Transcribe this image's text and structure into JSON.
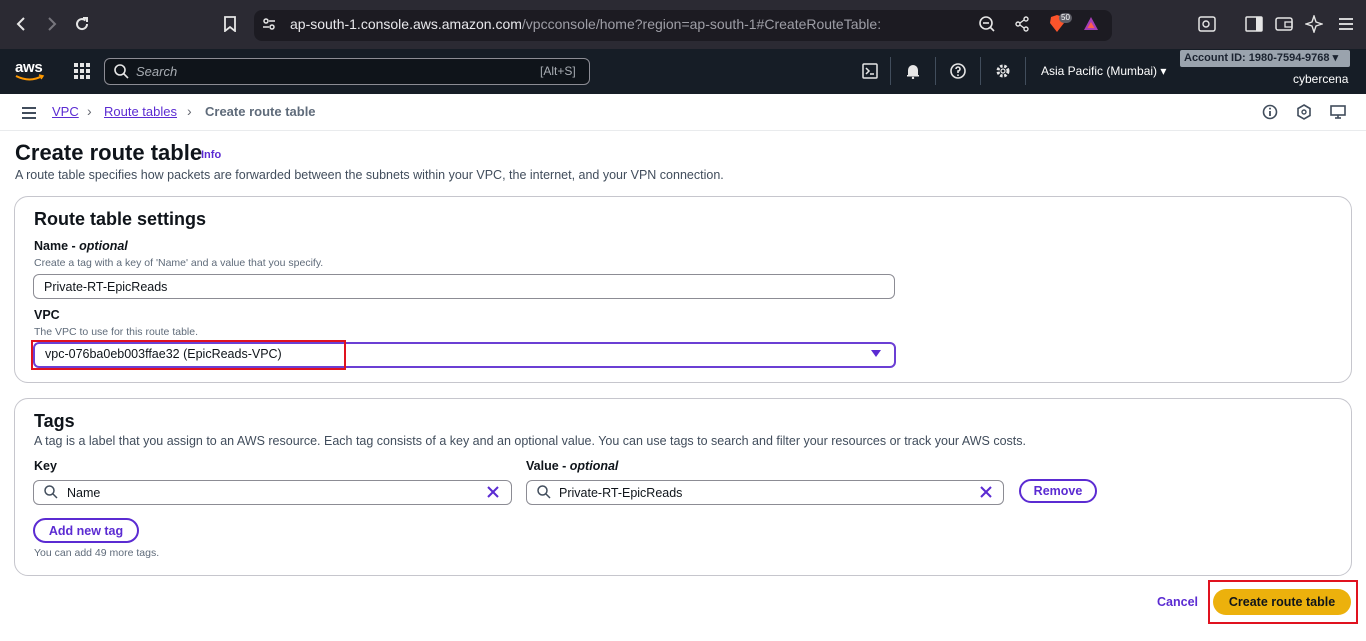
{
  "browser": {
    "url_host": "ap-south-1.console.aws.amazon.com",
    "url_path": "/vpcconsole/home?region=ap-south-1#CreateRouteTable:",
    "shield_count": "50"
  },
  "aws_nav": {
    "logo_text": "aws",
    "search_placeholder": "Search",
    "search_shortcut": "[Alt+S]",
    "region": "Asia Pacific (Mumbai)",
    "account_id": "Account ID: 1980-7594-9768",
    "username": "cybercena"
  },
  "breadcrumb": {
    "items": [
      "VPC",
      "Route tables"
    ],
    "current": "Create route table"
  },
  "page": {
    "title": "Create route table",
    "info": "Info",
    "description": "A route table specifies how packets are forwarded between the subnets within your VPC, the internet, and your VPN connection."
  },
  "settings": {
    "title": "Route table settings",
    "name_label": "Name - ",
    "name_optional": "optional",
    "name_hint": "Create a tag with a key of 'Name' and a value that you specify.",
    "name_value": "Private-RT-EpicReads",
    "vpc_label": "VPC",
    "vpc_hint": "The VPC to use for this route table.",
    "vpc_value": "vpc-076ba0eb003ffae32 (EpicReads-VPC)"
  },
  "tags": {
    "title": "Tags",
    "description": "A tag is a label that you assign to an AWS resource. Each tag consists of a key and an optional value. You can use tags to search and filter your resources or track your AWS costs.",
    "key_label": "Key",
    "value_label": "Value - ",
    "value_optional": "optional",
    "rows": [
      {
        "key": "Name",
        "value": "Private-RT-EpicReads"
      }
    ],
    "remove_label": "Remove",
    "add_label": "Add new tag",
    "limit_hint": "You can add 49 more tags."
  },
  "actions": {
    "cancel": "Cancel",
    "create": "Create route table"
  },
  "colors": {
    "accent": "#5b2bd2",
    "primary_button": "#ecb10c",
    "highlight_frame": "#e0121f",
    "nav_bg": "#161d26"
  }
}
